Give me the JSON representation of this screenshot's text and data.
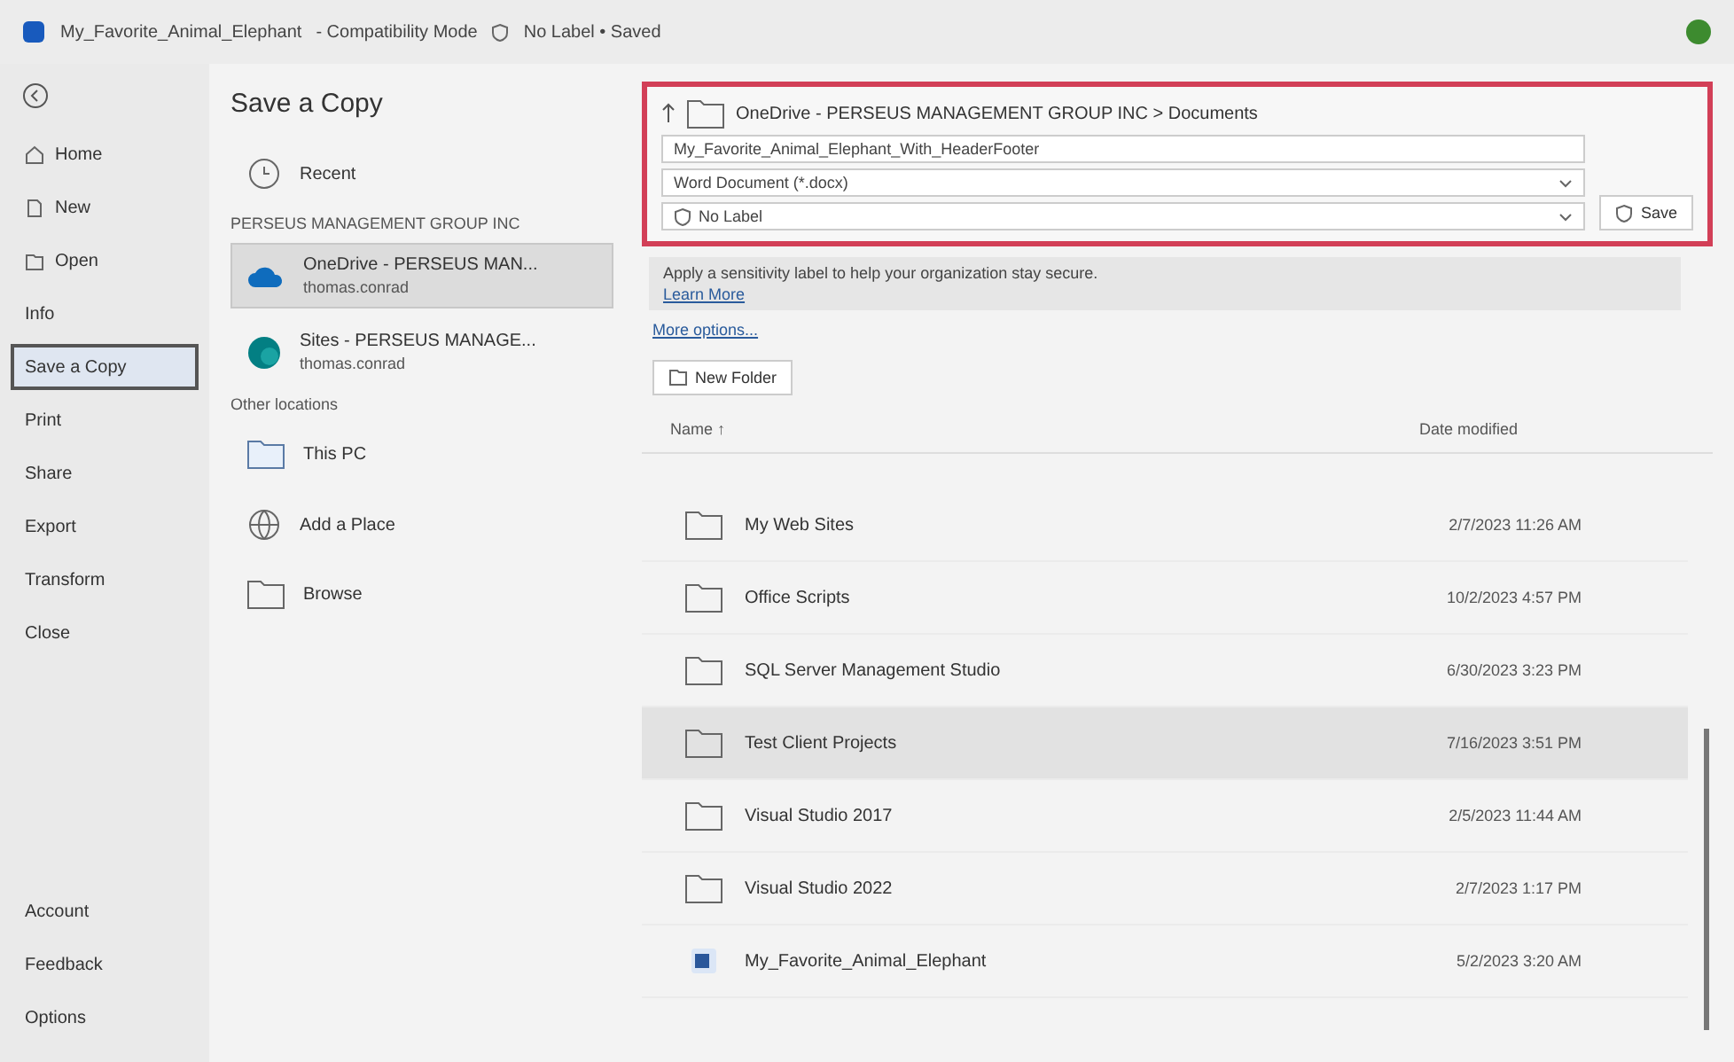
{
  "title_bar": {
    "document": "My_Favorite_Animal_Elephant",
    "mode": "- Compatibility Mode",
    "label": "No Label • Saved"
  },
  "sidebar": {
    "items": [
      {
        "label": "Home",
        "kind": "home",
        "selected": false
      },
      {
        "label": "New",
        "kind": "new",
        "selected": false
      },
      {
        "label": "Open",
        "kind": "open",
        "selected": false
      },
      {
        "label": "Info",
        "selected": false
      },
      {
        "label": "Save a Copy",
        "selected": true
      },
      {
        "label": "Print",
        "selected": false
      },
      {
        "label": "Share",
        "selected": false
      },
      {
        "label": "Export",
        "selected": false
      },
      {
        "label": "Transform",
        "selected": false
      },
      {
        "label": "Close",
        "selected": false
      }
    ],
    "bottom_items": [
      "Account",
      "Feedback",
      "Options"
    ]
  },
  "locations": {
    "heading": "Save a Copy",
    "recent": "Recent",
    "org": "PERSEUS MANAGEMENT GROUP INC",
    "org_items": [
      {
        "kind": "onedrive",
        "name": "OneDrive - PERSEUS MAN...",
        "account": "thomas.conrad",
        "selected": true
      },
      {
        "kind": "sites",
        "name": "Sites - PERSEUS MANAGE...",
        "account": "thomas.conrad",
        "selected": false
      }
    ],
    "other_heading": "Other locations",
    "other_items": [
      {
        "kind": "pc",
        "label": "This PC"
      },
      {
        "kind": "place",
        "label": "Add a Place"
      },
      {
        "kind": "browse",
        "label": "Browse"
      }
    ]
  },
  "save_panel": {
    "path": "OneDrive - PERSEUS MANAGEMENT GROUP INC > Documents",
    "file_name": "My_Favorite_Animal_Elephant_With_HeaderFooter",
    "file_type": "Word Document (*.docx)",
    "sensitivity": "No Label",
    "save": "Save",
    "notice": "Apply a sensitivity label to help your organization stay secure.",
    "learn_more": "Learn More",
    "more_options": "More options...",
    "new_folder": "New Folder"
  },
  "table": {
    "columns": [
      "Name ↑",
      "Date modified"
    ],
    "rows": [
      {
        "kind": "folder",
        "name": "My Web Sites",
        "date": "2/7/2023 11:26 AM",
        "selected": false
      },
      {
        "kind": "folder",
        "name": "Office Scripts",
        "date": "10/2/2023 4:57 PM",
        "selected": false
      },
      {
        "kind": "folder",
        "name": "SQL Server Management Studio",
        "date": "6/30/2023 3:23 PM",
        "selected": false
      },
      {
        "kind": "folder",
        "name": "Test Client Projects",
        "date": "7/16/2023 3:51 PM",
        "selected": true
      },
      {
        "kind": "folder",
        "name": "Visual Studio 2017",
        "date": "2/5/2023 11:44 AM",
        "selected": false
      },
      {
        "kind": "folder",
        "name": "Visual Studio 2022",
        "date": "2/7/2023 1:17 PM",
        "selected": false
      },
      {
        "kind": "word",
        "name": "My_Favorite_Animal_Elephant",
        "date": "5/2/2023 3:20 AM",
        "selected": false
      }
    ]
  }
}
